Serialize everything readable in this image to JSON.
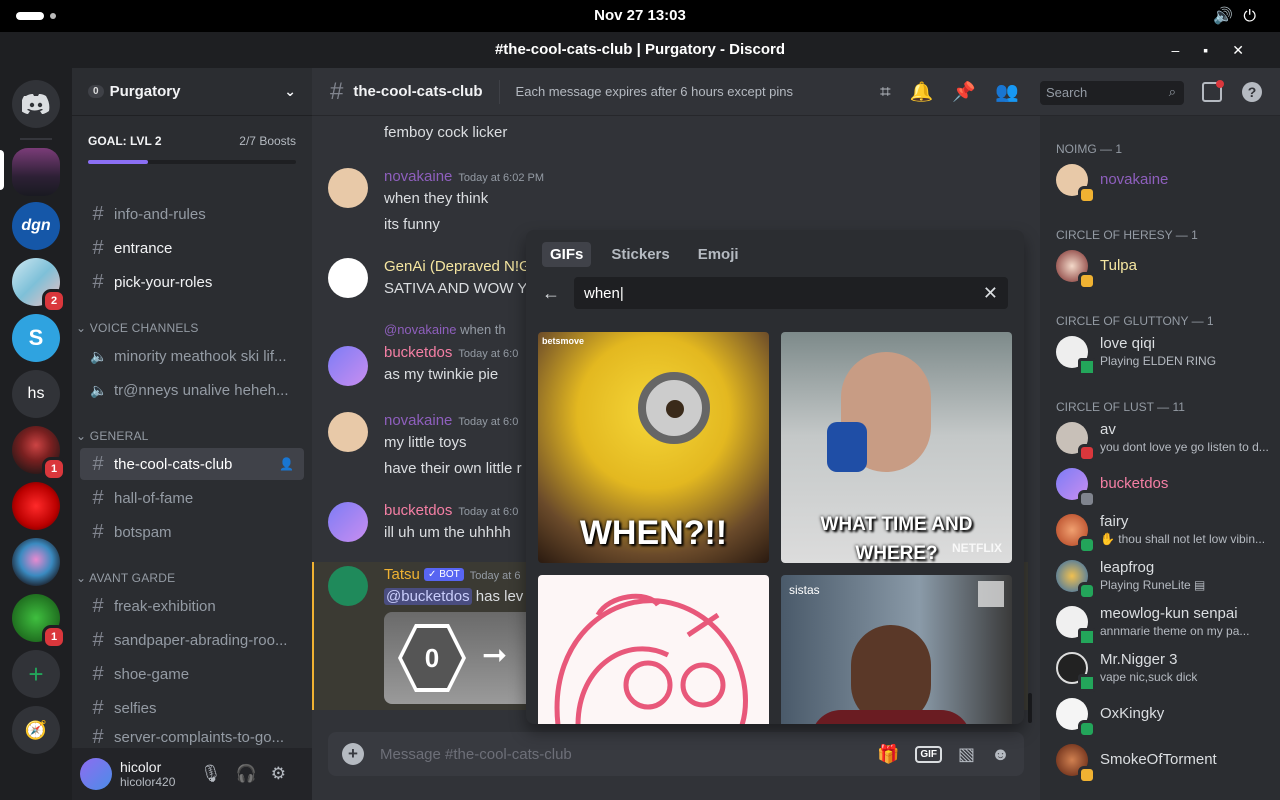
{
  "system": {
    "clock": "Nov 27  13:03"
  },
  "window": {
    "title": "#the-cool-cats-club | Purgatory - Discord"
  },
  "servers": {
    "badges": [
      "2",
      "1",
      "1",
      "1"
    ],
    "hs_label": "hs",
    "s_label": "S"
  },
  "guild": {
    "name": "Purgatory",
    "tag": "0",
    "goal_label": "GOAL: LVL 2",
    "boosts": "2/7 Boosts",
    "boost_progress": 0.29
  },
  "channels": {
    "top": [
      "info-and-rules",
      "entrance",
      "pick-your-roles"
    ],
    "voice_category": "VOICE CHANNELS",
    "voice": [
      "minority meathook ski lif...",
      "tr@nneys unalive heheh..."
    ],
    "general_category": "GENERAL",
    "general": [
      "the-cool-cats-club",
      "hall-of-fame",
      "botspam"
    ],
    "avant_category": "AVANT GARDE",
    "avant": [
      "freak-exhibition",
      "sandpaper-abrading-roo...",
      "shoe-game",
      "selfies",
      "server-complaints-to-go..."
    ]
  },
  "user": {
    "name": "hicolor",
    "tag": "hicolor420"
  },
  "chat": {
    "channel": "the-cool-cats-club",
    "topic": "Each message expires after 6 hours except pins",
    "placeholder": "Message #the-cool-cats-club",
    "messages": {
      "m0": "femboy cock licker",
      "m1_author": "novakaine",
      "m1_time": "Today at 6:02 PM",
      "m1_l1": "when they think",
      "m1_l2": "its funny",
      "m2_author": "GenAi (Depraved N!G",
      "m2_l1": "SATIVA AND WOW YC",
      "m3_reply_author": "@novakaine",
      "m3_reply_text": "when th",
      "m3_author": "bucketdos",
      "m3_time": "Today at 6:0",
      "m3_l1": "as my twinkie pie",
      "m4_author": "novakaine",
      "m4_time": "Today at 6:0",
      "m4_l1": "my little toys",
      "m4_l2": "have their own little r",
      "m5_author": "bucketdos",
      "m5_time": "Today at 6:0",
      "m5_l1": "ill uh um the uhhhh",
      "m6_author": "Tatsu",
      "m6_bot": "✓ BOT",
      "m6_time": "Today at 6",
      "m6_mention": "@bucketdos",
      "m6_text": " has lev",
      "m6_level": "0"
    }
  },
  "picker": {
    "tabs": [
      "GIFs",
      "Stickers",
      "Emoji"
    ],
    "query": "when",
    "gifs": [
      {
        "source": "betsmove",
        "caption": "WHEN?!!"
      },
      {
        "caption": "WHAT TIME AND WHERE?",
        "brand": "NETFLIX"
      },
      {
        "caption": ""
      },
      {
        "source": "sistas"
      }
    ]
  },
  "search": {
    "placeholder": "Search"
  },
  "members": {
    "groups": [
      "NOIMG — 1",
      "CIRCLE OF HERESY — 1",
      "CIRCLE OF GLUTTONY — 1",
      "CIRCLE OF LUST — 11"
    ],
    "list": [
      {
        "name": "novakaine",
        "sub": ""
      },
      {
        "name": "Tulpa",
        "sub": ""
      },
      {
        "name": "love qiqi",
        "sub": "Playing ELDEN RING"
      },
      {
        "name": "av",
        "sub": "you dont love ye go listen to d..."
      },
      {
        "name": "bucketdos",
        "sub": ""
      },
      {
        "name": "fairy",
        "sub": "✋ thou shall not let low vibin..."
      },
      {
        "name": "leapfrog",
        "sub": "Playing RuneLite ▤"
      },
      {
        "name": "meowlog-kun senpai",
        "sub": "annmarie theme on my pa..."
      },
      {
        "name": "Mr.Nigger 3",
        "sub": "vape nic,suck dick"
      },
      {
        "name": "OxKingky",
        "sub": ""
      },
      {
        "name": "SmokeOfTorment",
        "sub": ""
      }
    ]
  },
  "colors": {
    "accent": "#5865f2",
    "purple_name": "#8e5fbd",
    "pink_name": "#f47fa4",
    "gold_name": "#f0b232",
    "yellow_name": "#f5e6a1"
  }
}
